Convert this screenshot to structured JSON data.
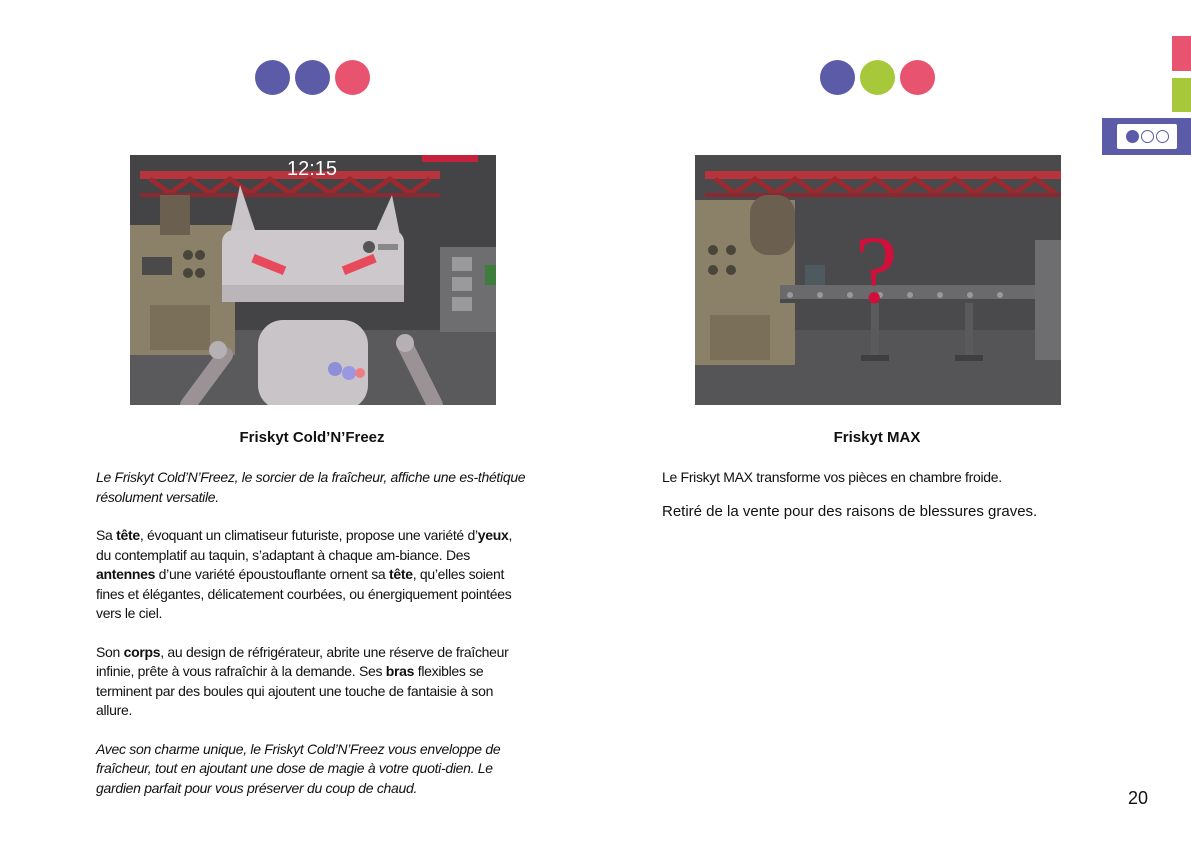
{
  "left": {
    "dot_colors": [
      "#5b5ba8",
      "#5b5ba8",
      "#e8546f"
    ],
    "image_clock": "12:15",
    "title": "Friskyt Cold’N’Freez",
    "intro_italic": "Le Friskyt Cold’N’Freez, le sorcier de la fraîcheur, affiche une es-thétique résolument versatile.",
    "p2": {
      "t1": "Sa ",
      "b1": "tête",
      "t2": ", évoquant un climatiseur futuriste, propose une variété d’",
      "b2": "yeux",
      "t3": ", du contemplatif au taquin, s’adaptant à chaque am-biance. Des ",
      "b3": "antennes",
      "t4": " d’une variété époustouflante ornent sa ",
      "b4": "tête",
      "t5": ", qu’elles soient fines et élégantes, délicatement courbées, ou énergiquement pointées vers le ciel."
    },
    "p3": {
      "t1": "Son ",
      "b1": "corps",
      "t2": ", au design de réfrigérateur, abrite une réserve de fraîcheur infinie, prête à vous rafraîchir à la demande. Ses ",
      "b2": "bras",
      "t3": " flexibles se terminent par des boules qui ajoutent une touche de fantaisie à son allure."
    },
    "outro_italic": "Avec son charme unique, le Friskyt Cold’N’Freez vous enveloppe de fraîcheur, tout en ajoutant une dose de magie à votre quoti-dien. Le gardien parfait pour vous préserver du coup de chaud."
  },
  "right": {
    "dot_colors": [
      "#5b5ba8",
      "#a8c83c",
      "#e8546f"
    ],
    "image_mark": "?",
    "title": "Friskyt MAX",
    "line1": "Le Friskyt MAX transforme vos pièces en chambre froide.",
    "line2": "Retiré de la vente pour des raisons de blessures graves."
  },
  "side_tabs": {
    "colors": [
      "#e8546f",
      "#a8c83c",
      "#5b5ba8"
    ]
  },
  "page_number": "20"
}
